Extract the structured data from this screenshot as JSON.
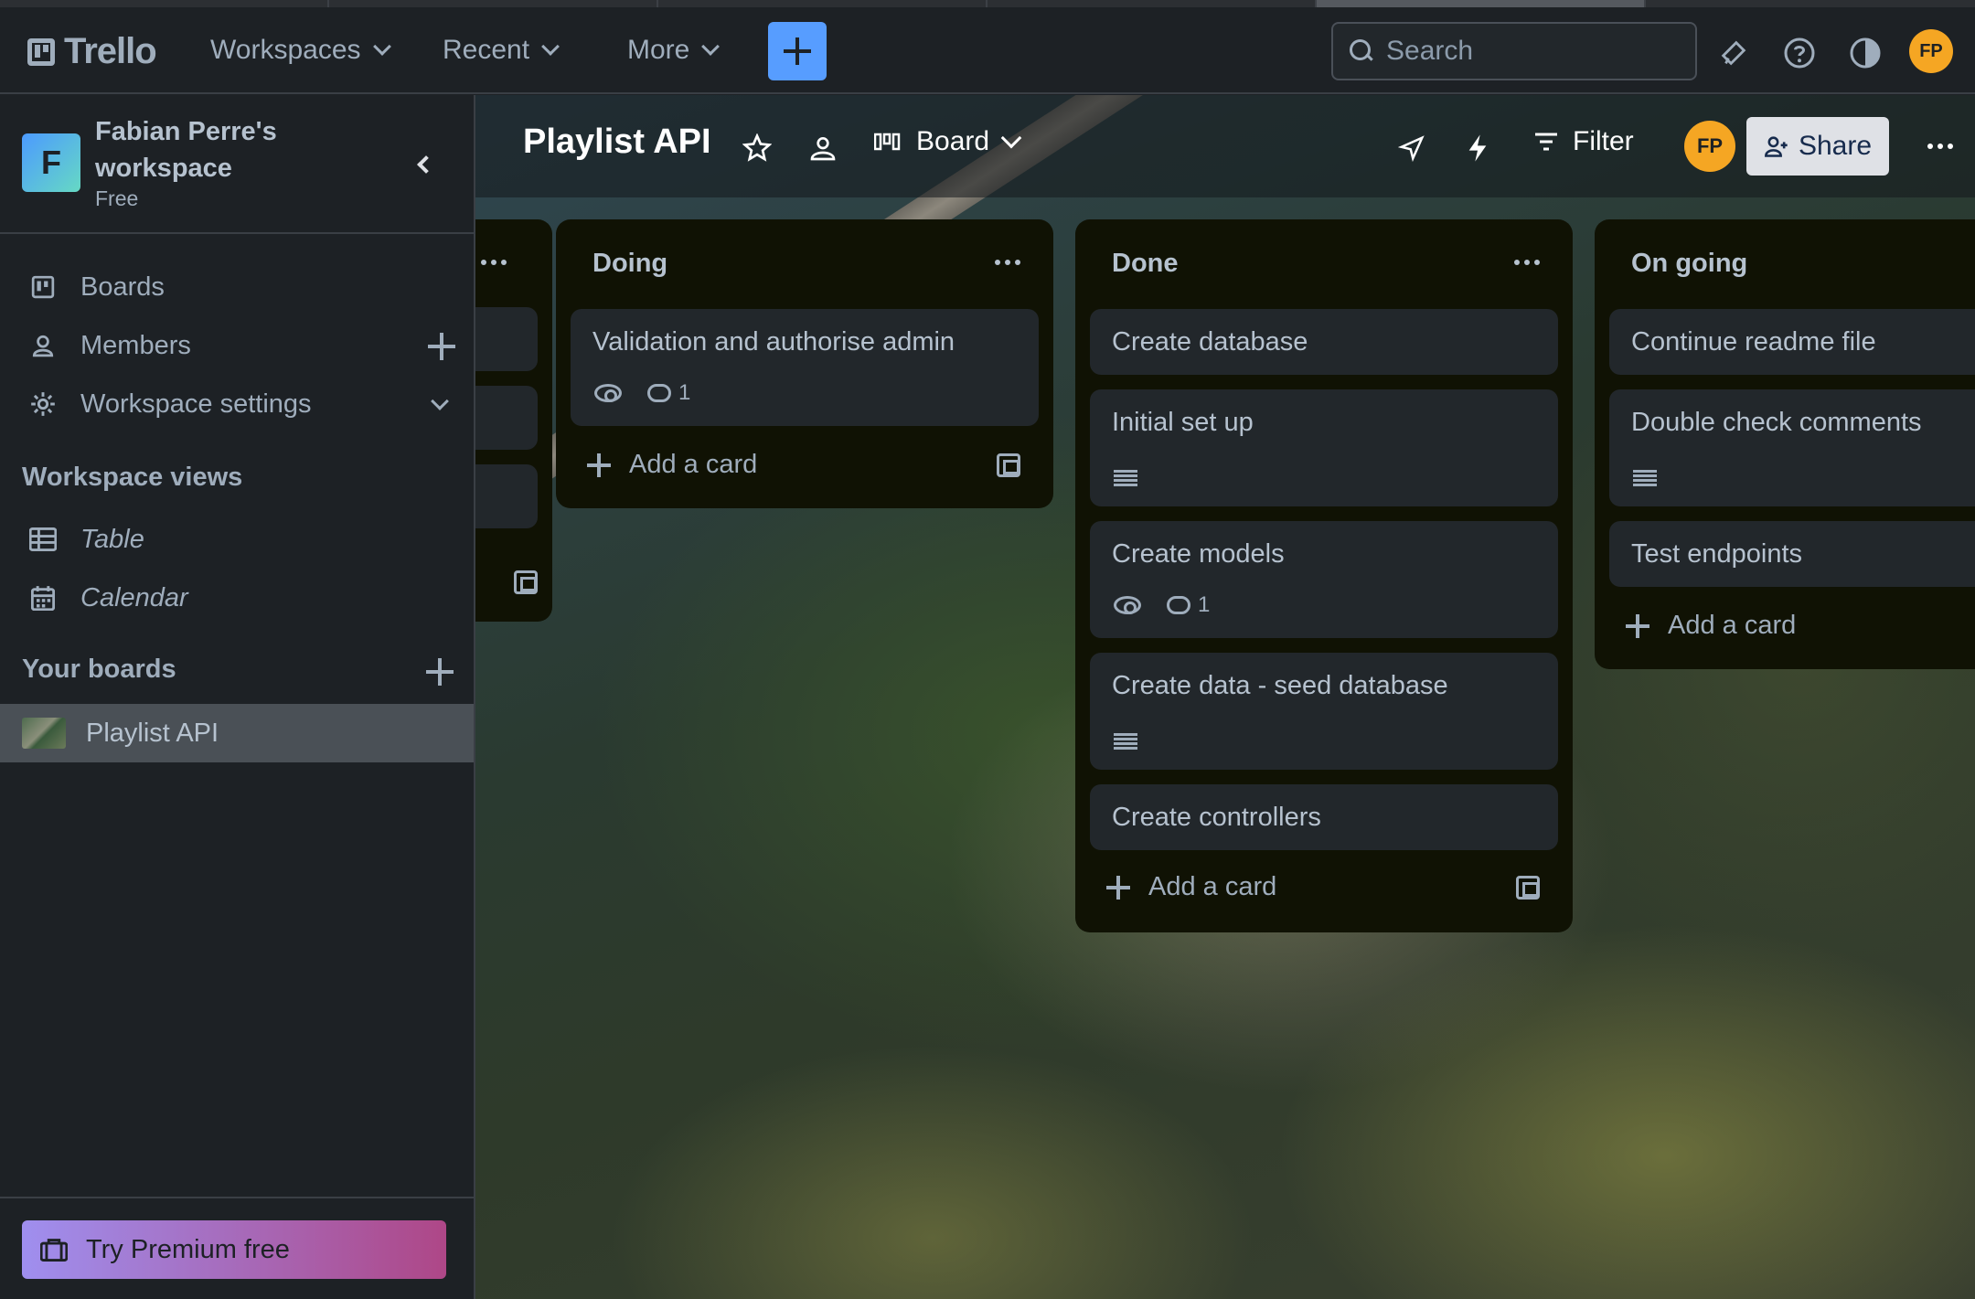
{
  "header": {
    "logo_text": "Trello",
    "menus": [
      "Workspaces",
      "Recent",
      "More"
    ],
    "search_placeholder": "Search",
    "avatar_initials": "FP"
  },
  "sidebar": {
    "workspace_initial": "F",
    "workspace_name": "Fabian Perre's workspace",
    "workspace_plan": "Free",
    "items": [
      {
        "label": "Boards",
        "icon": "board-icon"
      },
      {
        "label": "Members",
        "icon": "person-icon"
      },
      {
        "label": "Workspace settings",
        "icon": "gear-icon"
      }
    ],
    "views_heading": "Workspace views",
    "views": [
      {
        "label": "Table",
        "icon": "table-icon"
      },
      {
        "label": "Calendar",
        "icon": "calendar-icon"
      }
    ],
    "boards_heading": "Your boards",
    "boards": [
      {
        "label": "Playlist API"
      }
    ],
    "premium_label": "Try Premium free"
  },
  "board": {
    "title": "Playlist API",
    "view_label": "Board",
    "filter_label": "Filter",
    "member_initials": "FP",
    "share_label": "Share"
  },
  "lists": [
    {
      "title": "Doing",
      "cards": [
        {
          "title": "Validation and authorise admin",
          "watching": true,
          "comments": "1",
          "description": false
        }
      ],
      "add_label": "Add a card"
    },
    {
      "title": "Done",
      "cards": [
        {
          "title": "Create database"
        },
        {
          "title": "Initial set up",
          "description": true
        },
        {
          "title": "Create models",
          "watching": true,
          "comments": "1"
        },
        {
          "title": "Create data - seed database",
          "description": true
        },
        {
          "title": "Create controllers"
        }
      ],
      "add_label": "Add a card"
    },
    {
      "title": "On going",
      "cards": [
        {
          "title": "Continue readme file"
        },
        {
          "title": "Double check comments",
          "description": true
        },
        {
          "title": "Test endpoints"
        }
      ],
      "add_label": "Add a card"
    }
  ],
  "colors": {
    "accent": "#579dff",
    "avatar": "#f5a623",
    "list_bg": "#101204",
    "card_bg": "#22272b"
  }
}
